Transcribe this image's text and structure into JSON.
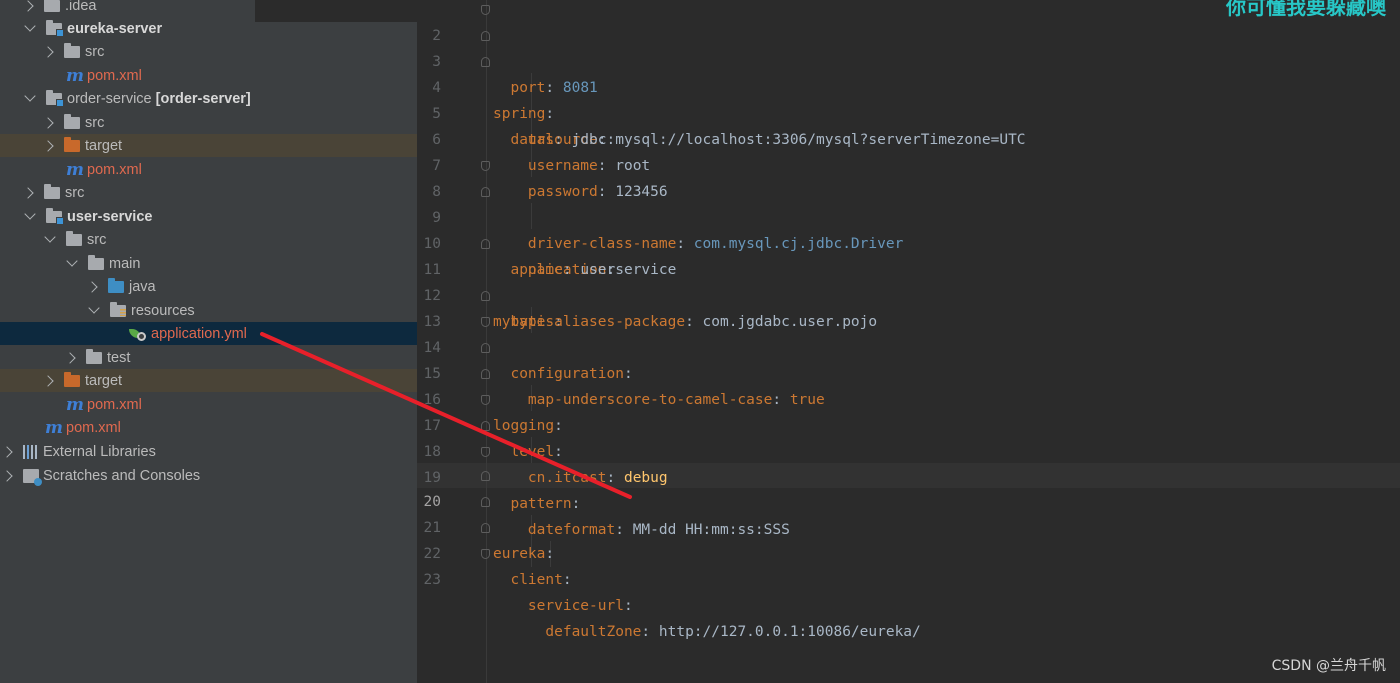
{
  "tree": {
    "items": [
      {
        "label": ".idea"
      },
      {
        "label": "eureka-server"
      },
      {
        "label": "src"
      },
      {
        "label": "pom.xml"
      },
      {
        "label": "order-service",
        "suffix": "[order-server]"
      },
      {
        "label": "src"
      },
      {
        "label": "target"
      },
      {
        "label": "pom.xml"
      },
      {
        "label": "src"
      },
      {
        "label": "user-service"
      },
      {
        "label": "src"
      },
      {
        "label": "main"
      },
      {
        "label": "java"
      },
      {
        "label": "resources"
      },
      {
        "label": "application.yml"
      },
      {
        "label": "test"
      },
      {
        "label": "target"
      },
      {
        "label": "pom.xml"
      },
      {
        "label": "pom.xml"
      },
      {
        "label": "External Libraries"
      },
      {
        "label": "Scratches and Consoles"
      }
    ],
    "m_glyph": "m"
  },
  "editor": {
    "current_line": "20",
    "lines": [
      {
        "n": "2",
        "key": "  port",
        "sep": ": ",
        "val": "8081"
      },
      {
        "n": "3",
        "key": "spring",
        "sep": ":",
        "val": ""
      },
      {
        "n": "4",
        "key": "  datasource",
        "sep": ":",
        "val": ""
      },
      {
        "n": "5",
        "key": "    url",
        "sep": ": ",
        "val": "jdbc:mysql://localhost:3306/mysql?serverTimezone=UTC"
      },
      {
        "n": "6",
        "key": "    username",
        "sep": ": ",
        "val": "root"
      },
      {
        "n": "7",
        "key": "    password",
        "sep": ": ",
        "val": "123456"
      },
      {
        "n": "8",
        "key": "    driver-class-name",
        "sep": ": ",
        "val": "com.mysql.cj.jdbc.Driver"
      },
      {
        "n": "9",
        "key": "  application",
        "sep": ":",
        "val": ""
      },
      {
        "n": "10",
        "key": "    name",
        "sep": ": ",
        "val": "userservice"
      },
      {
        "n": "11",
        "key": "mybatis",
        "sep": ":",
        "val": ""
      },
      {
        "n": "12",
        "key": "  type-aliases-package",
        "sep": ": ",
        "val": "com.jgdabc.user.pojo"
      },
      {
        "n": "13",
        "key": "  configuration",
        "sep": ":",
        "val": ""
      },
      {
        "n": "14",
        "key": "    map-underscore-to-camel-case",
        "sep": ": ",
        "val": "true"
      },
      {
        "n": "15",
        "key": "logging",
        "sep": ":",
        "val": ""
      },
      {
        "n": "16",
        "key": "  level",
        "sep": ":",
        "val": ""
      },
      {
        "n": "17",
        "key": "    cn.itcast",
        "sep": ": ",
        "val": "debug"
      },
      {
        "n": "18",
        "key": "  pattern",
        "sep": ":",
        "val": ""
      },
      {
        "n": "19",
        "key": "    dateformat",
        "sep": ": ",
        "val": "MM-dd HH:mm:ss:SSS"
      },
      {
        "n": "20",
        "key": "eureka",
        "sep": ":",
        "val": ""
      },
      {
        "n": "21",
        "key": "  client",
        "sep": ":",
        "val": ""
      },
      {
        "n": "22",
        "key": "    service-url",
        "sep": ":",
        "val": ""
      },
      {
        "n": "23",
        "key": "      defaultZone",
        "sep": ": ",
        "val": "http://127.0.0.1:10086/eureka/"
      }
    ]
  },
  "watermarks": {
    "top": "你可懂我要躲藏噢",
    "bottom": "CSDN @兰舟千帆"
  },
  "colors": {
    "key": "#cc7832",
    "value": "#a9b7c6",
    "number": "#6897bb",
    "annotation_arrow": "#e8202a"
  }
}
